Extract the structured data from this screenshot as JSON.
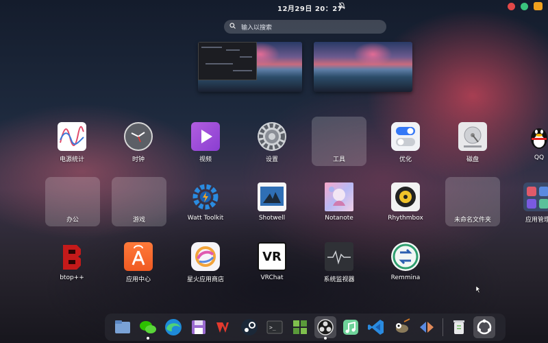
{
  "topbar": {
    "datetime": "12月29日  20：27",
    "notification_icon": "bell-off-icon",
    "tray": [
      "red-status-icon",
      "green-chat-icon",
      "orange-app-icon"
    ]
  },
  "search": {
    "placeholder": "输入以搜索",
    "icon": "search-icon"
  },
  "workspaces": [
    {
      "name": "workspace-1",
      "has_window": true
    },
    {
      "name": "workspace-2",
      "has_window": false
    }
  ],
  "apps": {
    "row1": [
      "电源统计",
      "时钟",
      "视频",
      "设置",
      "工具",
      "优化",
      "磁盘",
      "QQ"
    ],
    "row2": [
      "办公",
      "游戏",
      "Watt Toolkit",
      "Shotwell",
      "Notanote",
      "Rhythmbox",
      "未命名文件夹",
      "应用管理"
    ],
    "row3": [
      "btop++",
      "应用中心",
      "星火应用商店",
      "VRChat",
      "系统监视器",
      "Remmina"
    ]
  },
  "vr_icon_text": "VR",
  "dock": {
    "items": [
      "files-icon",
      "wechat-icon",
      "edge-icon",
      "floppy-icon",
      "wps-icon",
      "steam-icon",
      "terminal-icon",
      "extensions-icon",
      "obs-icon",
      "music-icon",
      "vscode-icon",
      "gimp-icon",
      "code-compare-icon",
      "trash-icon",
      "app-grid-icon"
    ],
    "terminal_text": ">_"
  },
  "colors": {
    "accent_blue": "#3478f6",
    "qq_red": "#e02020",
    "appcenter_orange": "#f05a22",
    "remmina_green": "#2e9e6e"
  }
}
